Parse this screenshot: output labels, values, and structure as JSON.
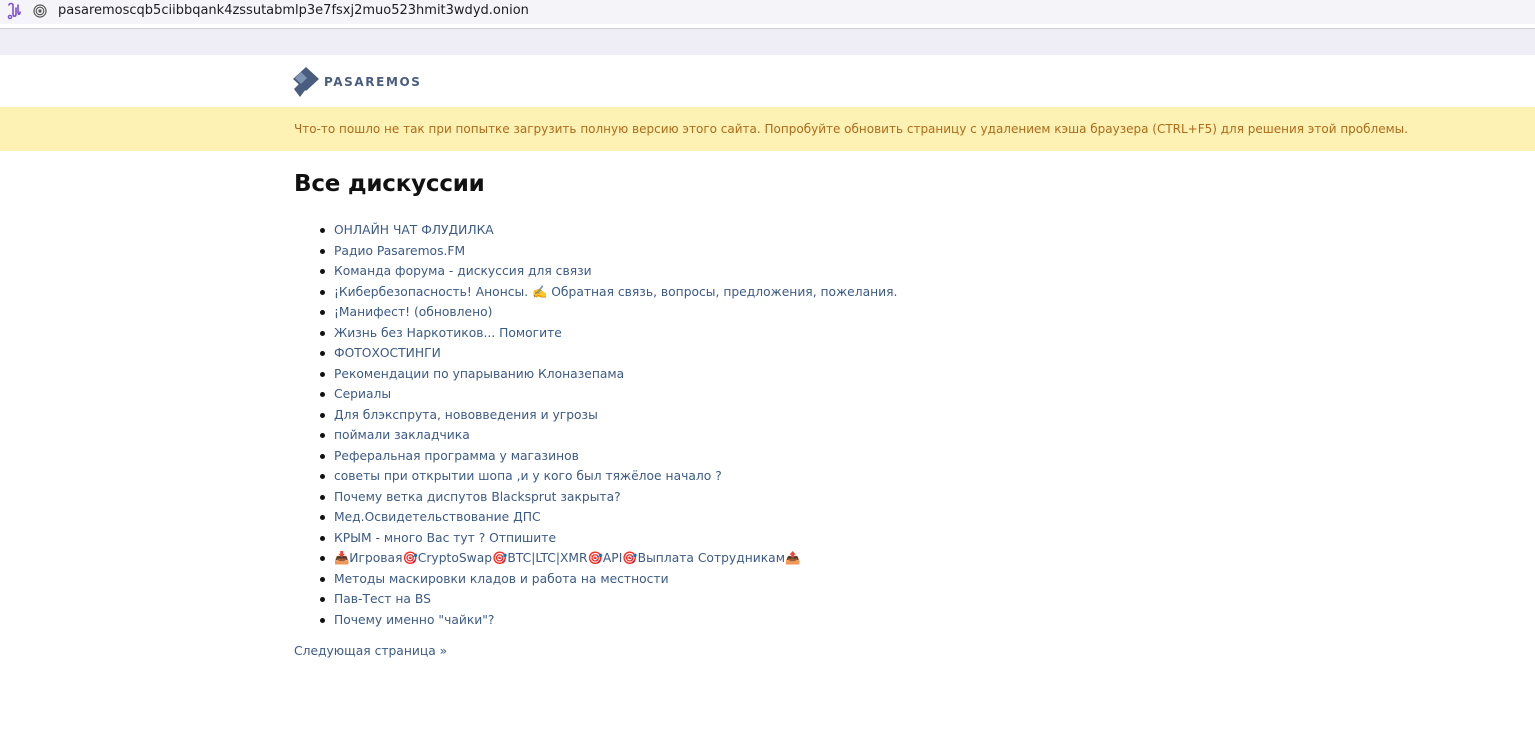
{
  "browser": {
    "url": "pasaremoscqb5ciibbqank4zssutabmlp3e7fsxj2muo523hmit3wdyd.onion"
  },
  "header": {
    "logo_text": "PASAREMOS"
  },
  "alert": {
    "message": "Что-то пошло не так при попытке загрузить полную версию этого сайта. Попробуйте обновить страницу с удалением кэша браузера (CTRL+F5) для решения этой проблемы."
  },
  "main": {
    "title": "Все дискуссии",
    "discussions": [
      "ОНЛАЙН ЧАТ ФЛУДИЛКА",
      "Радио Pasaremos.FM",
      "Команда форума - дискуссия для связи",
      "¡Кибербезопасность! Анонсы. ✍️ Обратная связь, вопросы, предложения, пожелания.",
      "¡Манифест! (обновлено)",
      "Жизнь без Наркотиков... Помогите",
      "ФОТОХОСТИНГИ",
      "Рекомендации по упарыванию Клоназепама",
      "Сериалы",
      "Для блэкспрута, нововведения и угрозы",
      "поймали закладчика",
      "Реферальная программа у магазинов",
      "советы при открытии шопа ,и у кого был тяжёлое начало ?",
      "Почему ветка диспутов Blacksprut закрыта?",
      "Мед.Освидетельствование ДПС",
      "КРЫМ - много Вас тут ? Отпишите",
      "📥Игровая🎯CryptoSwap🎯BTC|LTC|XMR🎯API🎯Выплата Сотрудникам📤",
      "Методы маскировки кладов и работа на местности",
      "Пав-Тест на BS",
      "Почему именно \"чайки\"?"
    ],
    "next_page": "Следующая страница »"
  },
  "colors": {
    "link": "#3c5a86",
    "alert_bg": "#fdf1b4",
    "alert_text": "#ad6c1a",
    "logo": "#4a5d7e"
  }
}
